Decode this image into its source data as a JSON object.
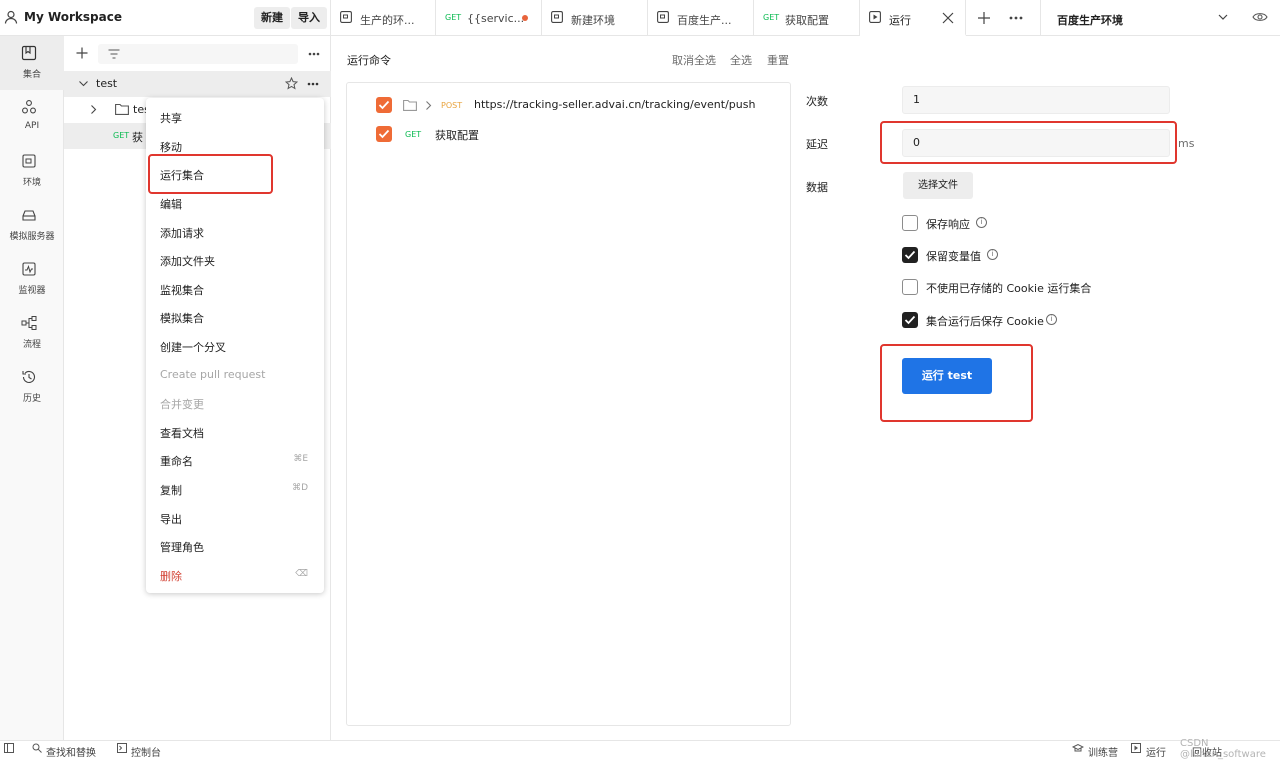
{
  "workspace": {
    "title": "My Workspace",
    "new_label": "新建",
    "import_label": "导入"
  },
  "tabs": [
    {
      "label": "生产的环...",
      "method": ""
    },
    {
      "label": "{{servic...",
      "method": "GET"
    },
    {
      "label": "新建环境",
      "method": ""
    },
    {
      "label": "百度生产...",
      "method": ""
    },
    {
      "label": "获取配置",
      "method": "GET"
    },
    {
      "label": "运行",
      "method": ""
    }
  ],
  "environment": {
    "selected": "百度生产环境"
  },
  "rail": [
    {
      "label": "集合"
    },
    {
      "label": "API"
    },
    {
      "label": "环境"
    },
    {
      "label": "模拟服务器"
    },
    {
      "label": "监视器"
    },
    {
      "label": "流程"
    },
    {
      "label": "历史"
    }
  ],
  "sidebar": {
    "collection_name": "test",
    "folder_name": "tes",
    "request_method": "GET",
    "request_name": "获"
  },
  "context_menu": [
    {
      "label": "共享",
      "shortcut": ""
    },
    {
      "label": "移动",
      "shortcut": ""
    },
    {
      "label": "运行集合",
      "shortcut": ""
    },
    {
      "label": "编辑",
      "shortcut": ""
    },
    {
      "label": "添加请求",
      "shortcut": ""
    },
    {
      "label": "添加文件夹",
      "shortcut": ""
    },
    {
      "label": "监视集合",
      "shortcut": ""
    },
    {
      "label": "模拟集合",
      "shortcut": ""
    },
    {
      "label": "创建一个分叉",
      "shortcut": ""
    },
    {
      "label": "Create pull request",
      "shortcut": "",
      "disabled": true
    },
    {
      "label": "合并变更",
      "shortcut": "",
      "disabled": true
    },
    {
      "label": "查看文档",
      "shortcut": ""
    },
    {
      "label": "重命名",
      "shortcut": "⌘E"
    },
    {
      "label": "复制",
      "shortcut": "⌘D"
    },
    {
      "label": "导出",
      "shortcut": ""
    },
    {
      "label": "管理角色",
      "shortcut": ""
    },
    {
      "label": "删除",
      "shortcut": "⌫",
      "danger": true
    }
  ],
  "runner": {
    "title": "运行命令",
    "deselect_all": "取消全选",
    "select_all": "全选",
    "reset": "重置",
    "requests": [
      {
        "method": "POST",
        "url": "https://tracking-seller.advai.cn/tracking/event/push",
        "method_color": "#e8a33d"
      },
      {
        "method": "GET",
        "url": "获取配置",
        "method_color": "#0cbb52"
      }
    ],
    "iterations_label": "次数",
    "iterations_value": "1",
    "delay_label": "延迟",
    "delay_value": "0",
    "delay_unit": "ms",
    "data_label": "数据",
    "select_file": "选择文件",
    "options": [
      {
        "label": "保存响应",
        "checked": false
      },
      {
        "label": "保留变量值",
        "checked": true
      },
      {
        "label": "不使用已存储的 Cookie 运行集合",
        "checked": false
      },
      {
        "label": "集合运行后保存 Cookie",
        "checked": true
      }
    ],
    "run_button": "运行 test"
  },
  "status_bar": {
    "find_replace": "查找和替换",
    "console": "控制台",
    "bootcamp": "训练营",
    "runner": "运行",
    "trash": "回收站"
  },
  "watermark": "CSDN @luhen_software",
  "colors": {
    "accent": "#1f74e6",
    "highlight": "#e0362e",
    "check": "#ef6b36"
  }
}
